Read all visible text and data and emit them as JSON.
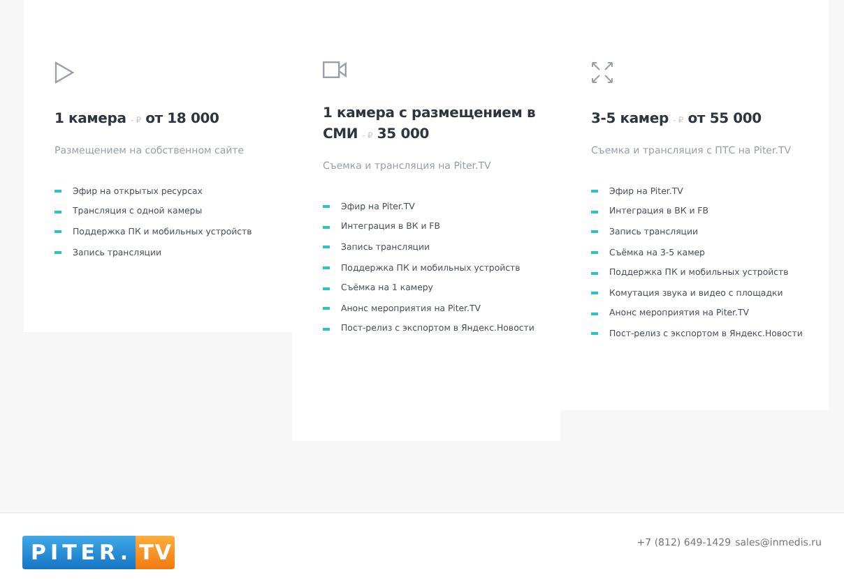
{
  "plans": [
    {
      "kind": "play",
      "name": "1 камера",
      "currency": "- ₽",
      "price": "от 18 000",
      "subtitle": "Размещением на собственном сайте",
      "features": [
        "Эфир на открытых ресурсах",
        "Трансляция с одной камеры",
        "Поддержка ПК и мобильных устройств",
        "Запись трансляции"
      ]
    },
    {
      "kind": "camera",
      "name": "1 камера с размещением в СМИ",
      "currency": "- ₽",
      "price": "35 000",
      "subtitle": "Съемка и трансляция на Piter.TV",
      "features": [
        "Эфир на Piter.TV",
        "Интеграция в ВК и FB",
        "Запись трансляции",
        "Поддержка ПК и мобильных устройств",
        "Съёмка на 1 камеру",
        "Анонс мероприятия на Piter.TV",
        "Пост-релиз с экспортом в Яндекс.Новости"
      ]
    },
    {
      "kind": "expand",
      "name": "3-5 камер",
      "currency": "- ₽",
      "price": "от 55 000",
      "subtitle": "Съемка и трансляция с ПТС на Piter.TV",
      "features": [
        "Эфир на Piter.TV",
        "Интеграция в ВК и FB",
        "Запись трансляции",
        "Съёмка на 3-5 камер",
        "Поддержка ПК и мобильных устройств",
        "Комутация звука и видео с площадки",
        "Анонс мероприятия на Piter.TV",
        "Пост-релиз с экспортом в Яндекс.Новости"
      ]
    }
  ],
  "footer": {
    "logo": {
      "left": "PITER.",
      "right": "TV"
    },
    "phone": "+7 (812) 649-1429",
    "email": "sales@inmedis.ru"
  }
}
